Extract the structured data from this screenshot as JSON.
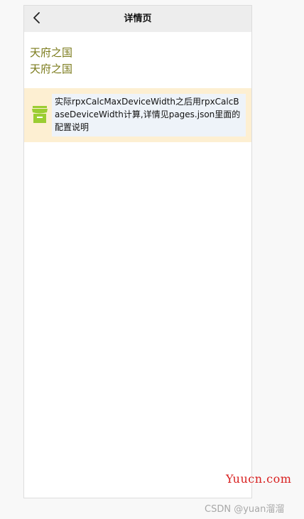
{
  "nav": {
    "title": "详情页",
    "back_icon": "chevron-left-icon"
  },
  "content": {
    "headline_lines": [
      "天府之国",
      "天府之国"
    ],
    "headline_color": "#7a7a1a",
    "notice": {
      "icon": "shop-icon",
      "icon_color": "#9bcd32",
      "text": "实际rpxCalcMaxDeviceWidth之后用rpxCalcBaseDeviceWidth计算,详情见pages.json里面的配置说明"
    }
  },
  "watermarks": {
    "site": "Yuucn.com",
    "credit": "CSDN @yuan溜溜"
  },
  "colors": {
    "nav_background": "#ededed",
    "notice_strip": "#fdefd2",
    "notice_box": "#eef3f9",
    "site_watermark": "#d81e1e"
  }
}
